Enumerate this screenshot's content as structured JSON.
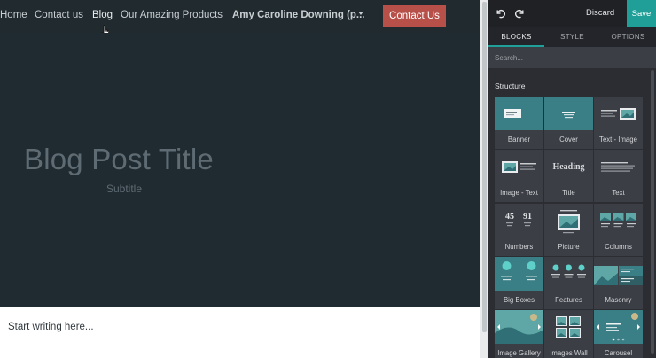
{
  "nav": {
    "links": [
      "Home",
      "Contact us",
      "Blog",
      "Our Amazing Products"
    ],
    "user": "Amy Caroline Downing (p...",
    "cta": "Contact Us"
  },
  "hero": {
    "title": "Blog Post Title",
    "subtitle": "Subtitle"
  },
  "content": {
    "placeholder": "Start writing here..."
  },
  "editor": {
    "discard": "Discard",
    "save": "Save",
    "tabs": [
      "BLOCKS",
      "STYLE",
      "OPTIONS"
    ],
    "active_tab": "BLOCKS",
    "search_placeholder": "Search...",
    "section": "Structure",
    "blocks": [
      {
        "label": "Banner",
        "icon": "banner-icon"
      },
      {
        "label": "Cover",
        "icon": "cover-icon"
      },
      {
        "label": "Text - Image",
        "icon": "text-image-icon"
      },
      {
        "label": "Image - Text",
        "icon": "image-text-icon"
      },
      {
        "label": "Title",
        "icon": "title-icon",
        "thumb_text": "Heading"
      },
      {
        "label": "Text",
        "icon": "text-icon"
      },
      {
        "label": "Numbers",
        "icon": "numbers-icon",
        "thumb_text": [
          "45",
          "91"
        ]
      },
      {
        "label": "Picture",
        "icon": "picture-icon"
      },
      {
        "label": "Columns",
        "icon": "columns-icon"
      },
      {
        "label": "Big Boxes",
        "icon": "big-boxes-icon"
      },
      {
        "label": "Features",
        "icon": "features-icon"
      },
      {
        "label": "Masonry",
        "icon": "masonry-icon"
      },
      {
        "label": "Image Gallery",
        "icon": "image-gallery-icon"
      },
      {
        "label": "Images Wall",
        "icon": "images-wall-icon"
      },
      {
        "label": "Carousel",
        "icon": "carousel-icon"
      }
    ]
  },
  "colors": {
    "accent": "#1f9f97",
    "cta": "#b8504a",
    "hero_bg": "#1f2a31",
    "panel_bg": "#2b2d33"
  }
}
